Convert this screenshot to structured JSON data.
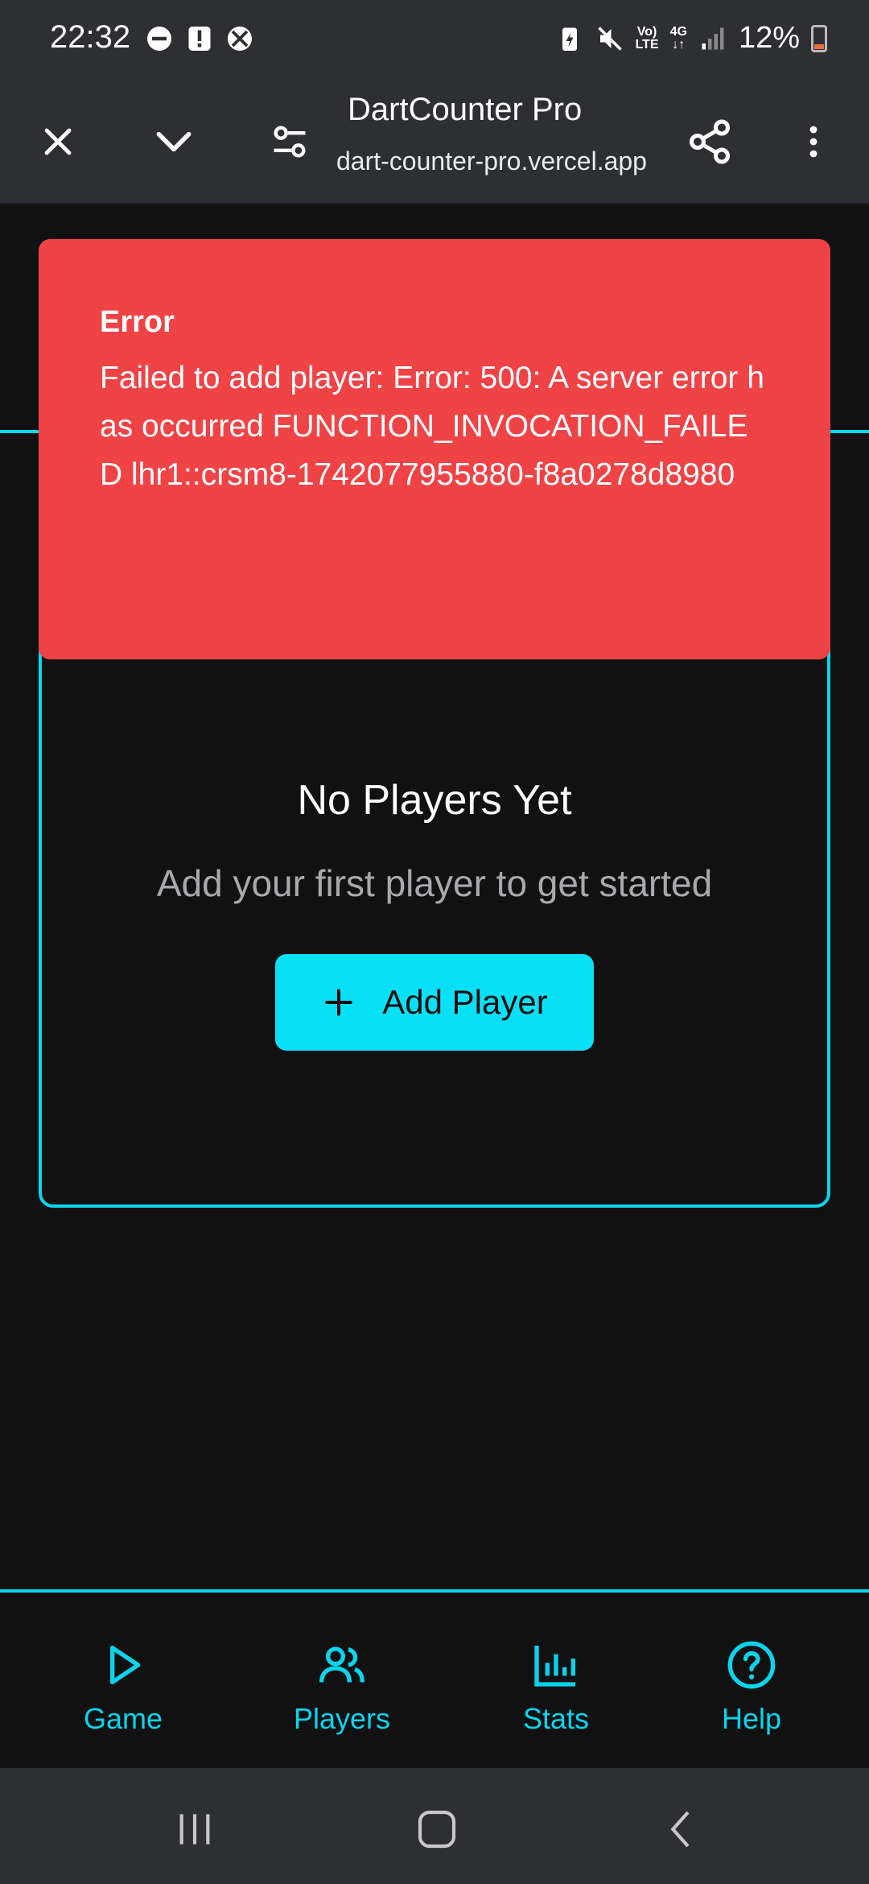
{
  "status_bar": {
    "time": "22:32",
    "battery": "12%",
    "network_tag_top": "Vo)",
    "network_tag_bottom": "LTE",
    "network_type": "4G",
    "icons": [
      "dnd-icon",
      "alert-icon",
      "xbox-icon",
      "battery-saver-icon",
      "mute-icon",
      "volte-icon",
      "data-4g-icon",
      "signal-icon",
      "battery-icon"
    ]
  },
  "browser": {
    "title": "DartCounter Pro",
    "url": "dart-counter-pro.vercel.app",
    "icons": [
      "close-icon",
      "chevron-down-icon",
      "site-settings-icon",
      "share-icon",
      "more-vert-icon"
    ]
  },
  "error": {
    "title": "Error",
    "message": "Failed to add player: Error: 500: A server error has occurred FUNCTION_INVOCATION_FAILED lhr1::crsm8-1742077955880-f8a0278d8980"
  },
  "empty_state": {
    "title": "No Players Yet",
    "subtitle": "Add your first player to get started",
    "button_label": "Add Player"
  },
  "bottom_nav": {
    "items": [
      {
        "label": "Game",
        "icon": "play-icon"
      },
      {
        "label": "Players",
        "icon": "users-icon"
      },
      {
        "label": "Stats",
        "icon": "bar-chart-icon"
      },
      {
        "label": "Help",
        "icon": "help-circle-icon"
      }
    ]
  },
  "colors": {
    "accent": "#08d4ee",
    "error": "#ef4346",
    "background": "#111112",
    "chrome": "#2e2f33"
  }
}
